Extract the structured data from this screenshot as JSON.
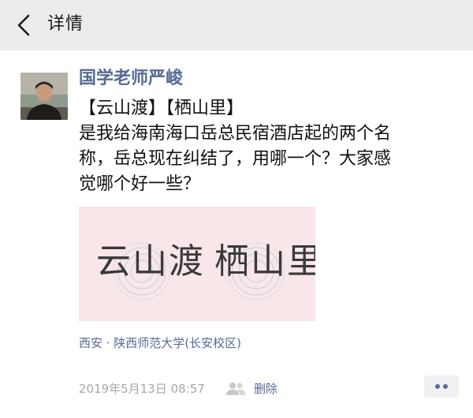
{
  "nav": {
    "title": "详情"
  },
  "post": {
    "author": "国学老师严峻",
    "text_lines": [
      "【云山渡】【栖山里】",
      "是我给海南海口岳总民宿酒店起的两个名",
      "称，岳总现在纠结了，用哪一个？大家感",
      "觉哪个好一些？"
    ],
    "image_text_left": "云山渡",
    "image_text_right": "栖山里",
    "location": "西安 · 陕西师范大学(长安校区)",
    "timestamp": "2019年5月13日 08:57",
    "delete_label": "删除"
  },
  "icons": {
    "back": "chevron-left-icon",
    "visibility": "friends-icon",
    "more": "more-dots-icon"
  },
  "colors": {
    "nav_background": "#ececec",
    "link_blue": "#576b95",
    "image_background": "#f8e6e9",
    "meta_gray": "#a8a8a8"
  }
}
